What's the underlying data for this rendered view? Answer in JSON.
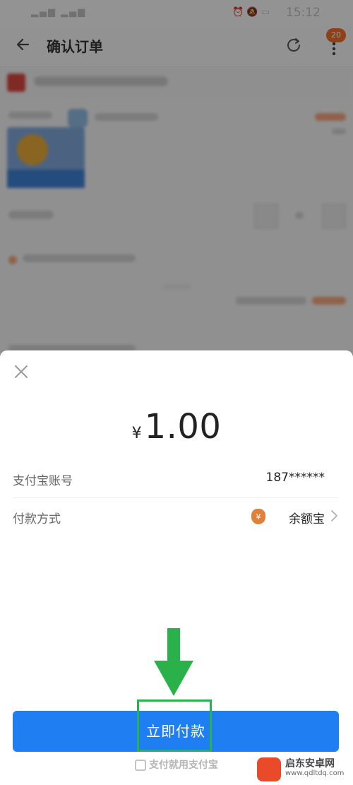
{
  "status_bar": {
    "time": "15:12"
  },
  "nav": {
    "title": "确认订单",
    "badge": "20"
  },
  "sheet": {
    "currency": "¥",
    "amount": "1.00",
    "account_label": "支付宝账号",
    "account_value": "187******",
    "method_label": "付款方式",
    "method_value": "余额宝",
    "pay_button": "立即付款",
    "footer_brand": "支付就用支付宝"
  },
  "watermark": {
    "line1": "启东安卓网",
    "line2": "www.qdltdq.com"
  },
  "colors": {
    "pay_button": "#1f7ef2",
    "highlight": "#2bb14a",
    "badge": "#f06a2a"
  },
  "icons": [
    "back-arrow-icon",
    "refresh-icon",
    "more-icon",
    "close-icon",
    "money-bag-icon",
    "chevron-right-icon",
    "down-arrow-icon",
    "alipay-icon"
  ]
}
